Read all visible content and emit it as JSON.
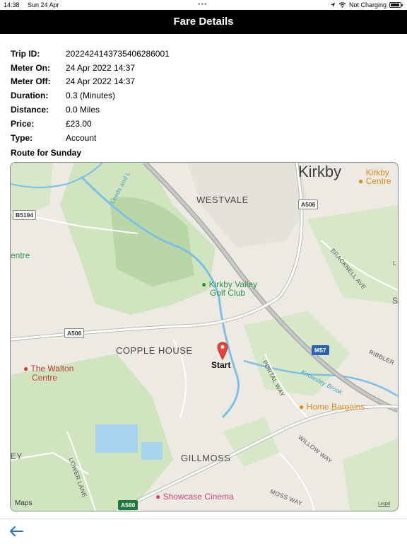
{
  "status_bar": {
    "time": "14:38",
    "date": "Sun 24 Apr",
    "charging": "Not Charging",
    "battery_level": 0.9,
    "icons": [
      "location-arrow-icon",
      "wifi-icon",
      "battery-icon"
    ]
  },
  "header": {
    "title": "Fare Details"
  },
  "details": [
    {
      "label": "Trip ID:",
      "value": "2022424143735406286001"
    },
    {
      "label": "Meter On:",
      "value": "24 Apr 2022 14:37"
    },
    {
      "label": "Meter Off:",
      "value": "24 Apr 2022 14:37"
    },
    {
      "label": "Duration:",
      "value": "0.3 (Minutes)"
    },
    {
      "label": "Distance:",
      "value": "0.0 Miles"
    },
    {
      "label": "Price:",
      "value": "£23.00"
    },
    {
      "label": "Type:",
      "value": "Account"
    }
  ],
  "route": {
    "title": "Route for Sunday",
    "map": {
      "city": "Kirkby",
      "districts": {
        "westvale": "WESTVALE",
        "copple_house": "COPPLE HOUSE",
        "gillmoss": "GILLMOSS"
      },
      "pois": {
        "kirkby_centre": "Kirkby Centre",
        "golf_line1": "Kirkby Valley",
        "golf_line2": "Golf Club",
        "walton_line1": "The Walton",
        "walton_line2": "Centre",
        "centre_partial": "entre",
        "home_bargains": "Home Bargains",
        "showcase": "Showcase Cinema"
      },
      "roads": {
        "b5194": "B5194",
        "a506_top": "A506",
        "a506_left": "A506",
        "m57": "M57",
        "a580": "A580"
      },
      "streets": {
        "leeds": "Leeds and L",
        "bracknell": "BRACKNELL AVE",
        "ribbler": "RIBBLER",
        "portal": "PORTAL WAY",
        "willow": "WILLOW WAY",
        "lower_lane": "LOWER LANE",
        "moss": "MOSS WAY",
        "brook": "Knowsley Brook",
        "ey": "EY",
        "l": "L",
        "s": "S"
      },
      "start_label": "Start",
      "logo": "Maps",
      "legal": "Legal"
    }
  },
  "colors": {
    "header_bg": "#000000",
    "back_arrow": "#1f74c8"
  }
}
